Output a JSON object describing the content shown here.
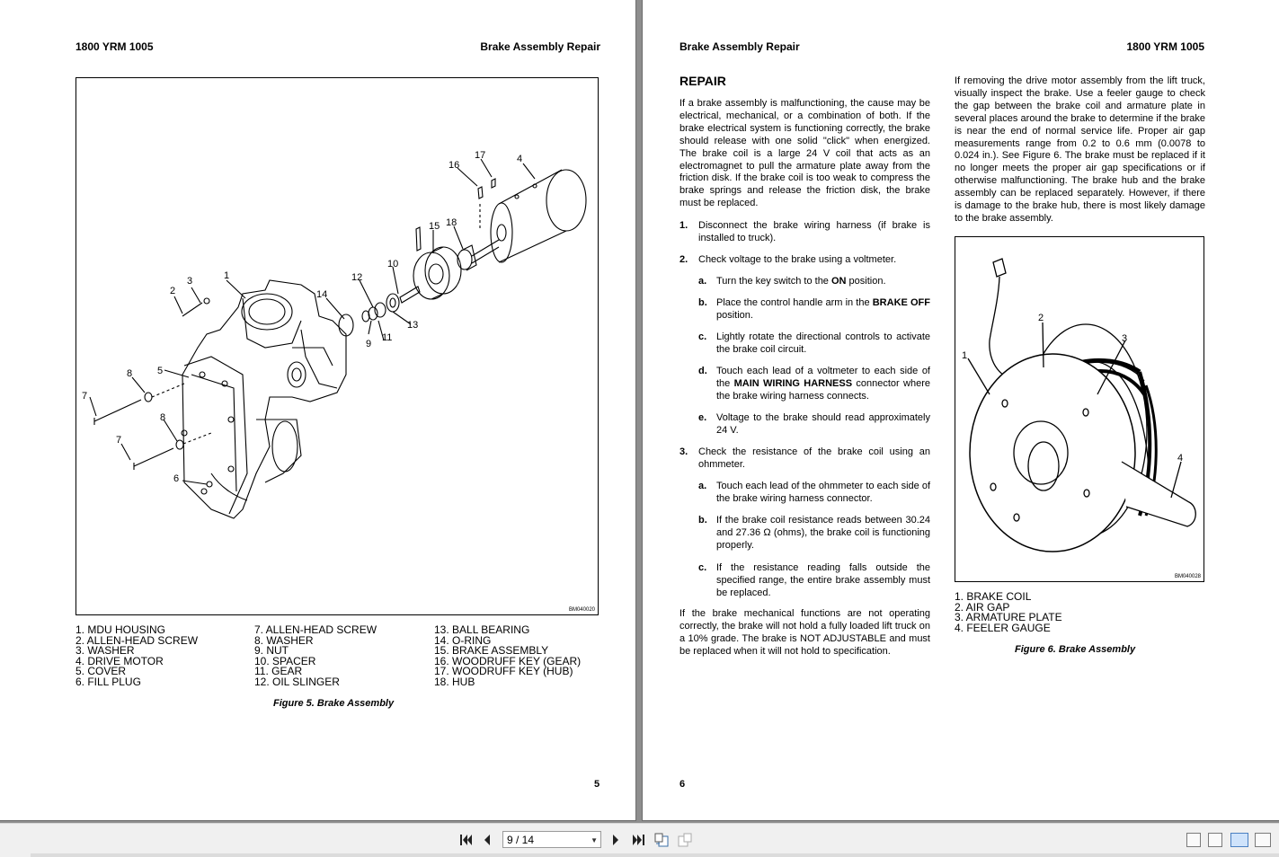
{
  "left_page": {
    "header_left": "1800 YRM 1005",
    "header_right": "Brake Assembly Repair",
    "figure_code": "BM040020",
    "callouts": [
      "1",
      "2",
      "3",
      "4",
      "5",
      "6",
      "7",
      "7",
      "8",
      "8",
      "9",
      "10",
      "11",
      "12",
      "13",
      "14",
      "15",
      "16",
      "17",
      "18"
    ],
    "legend_col1": [
      "1.  MDU HOUSING",
      "2.  ALLEN-HEAD SCREW",
      "3.  WASHER",
      "4.  DRIVE MOTOR",
      "5.  COVER",
      "6.  FILL PLUG"
    ],
    "legend_col2": [
      "7.   ALLEN-HEAD SCREW",
      "8.   WASHER",
      "9.   NUT",
      "10. SPACER",
      "11. GEAR",
      "12. OIL SLINGER"
    ],
    "legend_col3": [
      "13. BALL BEARING",
      "14. O-RING",
      "15. BRAKE ASSEMBLY",
      "16. WOODRUFF KEY (GEAR)",
      "17. WOODRUFF KEY (HUB)",
      "18. HUB"
    ],
    "caption": "Figure 5.  Brake Assembly",
    "page_number": "5"
  },
  "right_page": {
    "header_left": "Brake Assembly Repair",
    "header_right": "1800 YRM 1005",
    "section_title": "REPAIR",
    "intro": "If a brake assembly is malfunctioning, the cause may be electrical, mechanical, or a combination of both. If the brake electrical system is functioning correctly, the brake should release with one solid \"click\" when energized. The brake coil is a large 24 V coil that acts as an electromagnet to pull the armature plate away from the friction disk. If the brake coil is too weak to compress the brake springs and release the friction disk, the brake must be replaced.",
    "step1_num": "1.",
    "step1": "Disconnect the brake wiring harness (if brake is installed to truck).",
    "step2_num": "2.",
    "step2": "Check voltage to the brake using a voltmeter.",
    "step2a_letter": "a.",
    "step2a_pre": "Turn the key switch to the ",
    "step2a_bold": "ON",
    "step2a_post": " position.",
    "step2b_letter": "b.",
    "step2b_pre": "Place the control handle arm in the ",
    "step2b_bold": "BRAKE OFF",
    "step2b_post": " position.",
    "step2c_letter": "c.",
    "step2c": "Lightly rotate the directional controls to activate the brake coil circuit.",
    "step2d_letter": "d.",
    "step2d_pre": "Touch each lead of a voltmeter to each side of the ",
    "step2d_bold": "MAIN WIRING HARNESS",
    "step2d_post": " connector where the brake wiring harness connects.",
    "step2e_letter": "e.",
    "step2e": "Voltage to the brake should read approximately 24 V.",
    "step3_num": "3.",
    "step3": "Check the resistance of the brake coil using an ohmmeter.",
    "step3a_letter": "a.",
    "step3a": "Touch each lead of the ohmmeter to each side of the brake wiring harness connector.",
    "step3b_letter": "b.",
    "step3b": "If the brake coil resistance reads between 30.24 and 27.36 Ω (ohms), the brake coil is functioning properly.",
    "step3c_letter": "c.",
    "step3c": "If the resistance reading falls outside the specified range, the entire brake assembly must be replaced.",
    "closing": "If the brake mechanical functions are not operating correctly, the brake will not hold a fully loaded lift truck on a 10% grade. The brake is NOT ADJUSTABLE and must be replaced when it will not hold to specification.",
    "col2_text": "If removing the drive motor assembly from the lift truck, visually inspect the brake. Use a feeler gauge to check the gap between the brake coil and armature plate in several places around the brake to determine if the brake is near the end of normal service life. Proper air gap measurements range from 0.2 to 0.6 mm (0.0078 to 0.024 in.). See Figure 6. The brake must be replaced if it no longer meets the proper air gap specifications or if otherwise malfunctioning. The brake hub and the brake assembly can be replaced separately. However, if there is damage to the brake hub, there is most likely damage to the brake assembly.",
    "figure_code": "BM040028",
    "callouts": [
      "1",
      "2",
      "3",
      "4"
    ],
    "legend": [
      "1.  BRAKE COIL",
      "2.  AIR GAP",
      "3.  ARMATURE PLATE",
      "4.  FEELER GAUGE"
    ],
    "caption": "Figure 6.  Brake Assembly",
    "page_number": "6"
  },
  "toolbar": {
    "page_indicator": "9 / 14"
  }
}
